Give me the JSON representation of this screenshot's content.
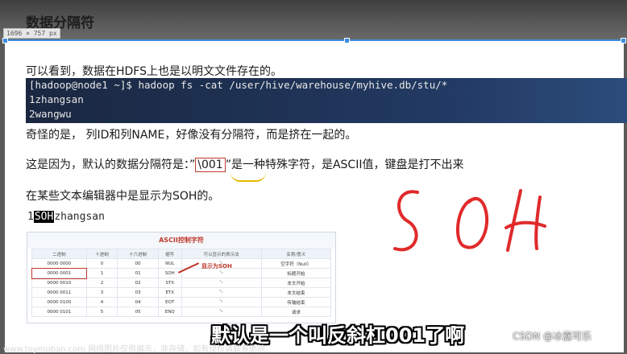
{
  "heading": "数据分隔符",
  "dimension_badge": "1696 × 757 px",
  "lines": {
    "intro": "可以看到，数据在HDFS上也是以明文文件存在的。",
    "strange": "奇怪的是， 列ID和列NAME，好像没有分隔符，而是挤在一起的。",
    "reason_before": "这是因为，默认的数据分隔符是：”",
    "reason_code": "\\001",
    "reason_after": "”是一种特殊字符，是ASCII值，键盘是打不出来",
    "editor": "在某些文本编辑器中是显示为SOH的。"
  },
  "terminal": {
    "command": "[hadoop@node1 ~]$ hadoop fs -cat /user/hive/warehouse/myhive.db/stu/*",
    "row1": "1zhangsan",
    "row2": "2wangwu"
  },
  "soh_example": {
    "prefix": "1",
    "soh": "SOH",
    "suffix": "zhangsan"
  },
  "ascii_table": {
    "title": "ASCII控制字符",
    "headers": [
      "二进制",
      "十进制",
      "十六进制",
      "缩写",
      "可以显示的表示法",
      "名称/意义"
    ],
    "rows": [
      [
        "0000 0000",
        "0",
        "00",
        "NUL",
        "␀",
        "空字符（Null）"
      ],
      [
        "0000 0001",
        "1",
        "01",
        "SOH",
        "␁",
        "标题开始"
      ],
      [
        "0000 0010",
        "2",
        "02",
        "STX",
        "␂",
        "本文开始"
      ],
      [
        "0000 0011",
        "3",
        "03",
        "ETX",
        "␃",
        "本文结束"
      ],
      [
        "0000 0100",
        "4",
        "04",
        "EOT",
        "␄",
        "传输结束"
      ],
      [
        "0000 0101",
        "5",
        "05",
        "ENQ",
        "␅",
        "请求"
      ]
    ],
    "annotation": "显示为SOH"
  },
  "handwriting_text": "SOH",
  "subtitle": "默认是一个叫反斜杠001了啊",
  "watermark_left": "www.toymoban.com 网络图片仅供展示，非存储，如有侵权请联系删除。",
  "watermark_right": "CSDN @冰露可乐",
  "colors": {
    "accent_red": "#c0392b",
    "selection_blue": "#3c8de0",
    "terminal_bg": "#1a2740"
  }
}
